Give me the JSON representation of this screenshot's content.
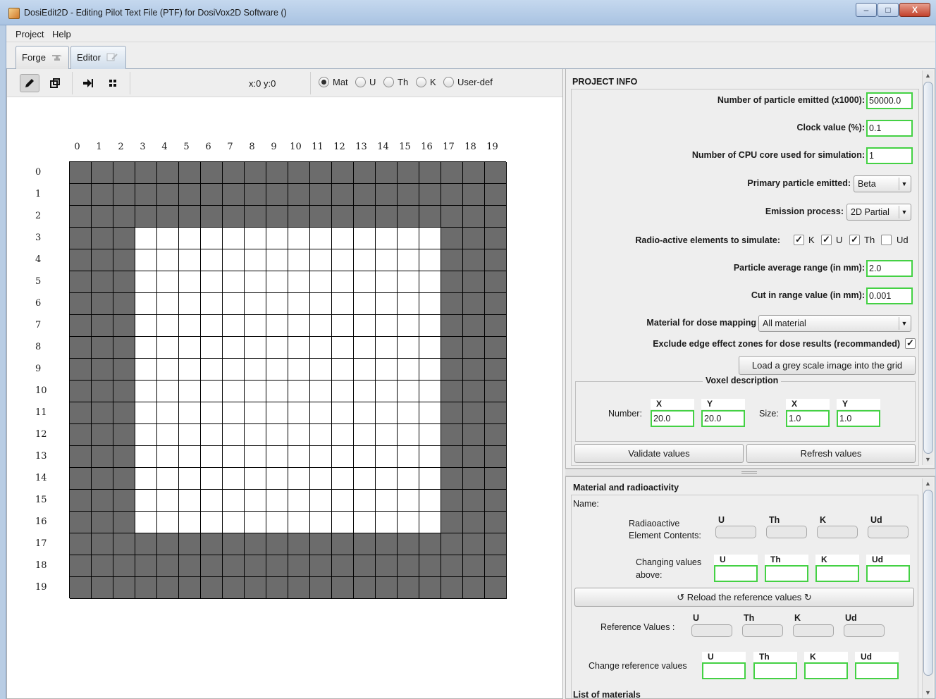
{
  "window": {
    "title": "DosiEdit2D - Editing Pilot Text File (PTF) for DosiVox2D Software ()",
    "minimize": "–",
    "maximize": "□",
    "close": "X"
  },
  "menu": {
    "project": "Project",
    "help": "Help"
  },
  "tabs": {
    "forge": "Forge",
    "editor": "Editor"
  },
  "toolbar": {
    "coords": "x:0 y:0",
    "radios": {
      "mat": "Mat",
      "u": "U",
      "th": "Th",
      "k": "K",
      "userdef": "User-def"
    },
    "selected": "Mat"
  },
  "grid": {
    "columns": [
      "0",
      "1",
      "2",
      "3",
      "4",
      "5",
      "6",
      "7",
      "8",
      "9",
      "10",
      "11",
      "12",
      "13",
      "14",
      "15",
      "16",
      "17",
      "18",
      "19"
    ],
    "rows": [
      "0",
      "1",
      "2",
      "3",
      "4",
      "5",
      "6",
      "7",
      "8",
      "9",
      "10",
      "11",
      "12",
      "13",
      "14",
      "15",
      "16",
      "17",
      "18",
      "19"
    ],
    "cells": [
      "GGGGGGGGGGGGGGGGGGGG",
      "GGGGGGGGGGGGGGGGGGGG",
      "GGGGGGGGGGGGGGGGGGGG",
      "GGGWWWWWWWWWWWWWWGGG",
      "GGGWWWWWWWWWWWWWWGGG",
      "GGGWWWWWWWWWWWWWWGGG",
      "GGGWWWWWWWWWWWWWWGGG",
      "GGGWWWWWWWWWWWWWWGGG",
      "GGGWWWWWWWWWWWWWWGGG",
      "GGGWWWWWWWWWWWWWWGGG",
      "GGGWWWWWWWWWWWWWWGGG",
      "GGGWWWWWWWWWWWWWWGGG",
      "GGGWWWWWWWWWWWWWWGGG",
      "GGGWWWWWWWWWWWWWWGGG",
      "GGGWWWWWWWWWWWWWWGGG",
      "GGGWWWWWWWWWWWWWWGGG",
      "GGGWWWWWWWWWWWWWWGGG",
      "GGGGGGGGGGGGGGGGGGGG",
      "GGGGGGGGGGGGGGGGGGGG",
      "GGGGGGGGGGGGGGGGGGGG"
    ],
    "colors": {
      "G": "#6c6c6c",
      "W": "#ffffff"
    }
  },
  "project_info": {
    "header": "PROJECT INFO",
    "particles_label": "Number of particle emitted (x1000):",
    "particles_value": "50000.0",
    "clock_label": "Clock value (%):",
    "clock_value": "0.1",
    "cpu_label": "Number of CPU core used for simulation:",
    "cpu_value": "1",
    "primary_label": "Primary particle emitted:",
    "primary_value": "Beta",
    "emission_label": "Emission process:",
    "emission_value": "2D Partial",
    "radio_label": "Radio-active elements to simulate:",
    "elements": [
      {
        "name": "K",
        "checked": true
      },
      {
        "name": "U",
        "checked": true
      },
      {
        "name": "Th",
        "checked": true
      },
      {
        "name": "Ud",
        "checked": false
      }
    ],
    "range_label": "Particle average range (in mm):",
    "range_value": "2.0",
    "cut_label": "Cut in range value (in mm):",
    "cut_value": "0.001",
    "dose_material_label": "Material for dose mapping",
    "dose_material_value": "All material",
    "exclude_label": "Exclude edge effect zones for dose results (recommanded)",
    "exclude_checked": true,
    "load_image_button": "Load a grey scale image into the grid",
    "voxel": {
      "title": "Voxel description",
      "number_label": "Number:",
      "size_label": "Size:",
      "number_x_header": "X",
      "number_y_header": "Y",
      "size_x_header": "X",
      "size_y_header": "Y",
      "number_x": "20.0",
      "number_y": "20.0",
      "size_x": "1.0",
      "size_y": "1.0"
    },
    "validate_button": "Validate values",
    "refresh_button": "Refresh values"
  },
  "material": {
    "header": "Material and radioactivity",
    "name_label": "Name:",
    "radioactive_label_1": "Radiaoactive",
    "radioactive_label_2": "Element Contents:",
    "changing_label_1": "Changing values",
    "changing_label_2": "above:",
    "element_headers": [
      "U",
      "Th",
      "K",
      "Ud"
    ],
    "reload_button": "↺ Reload the reference values ↻",
    "reference_label": "Reference Values :",
    "change_reference_label": "Change reference values",
    "next_section": "List of materials"
  }
}
